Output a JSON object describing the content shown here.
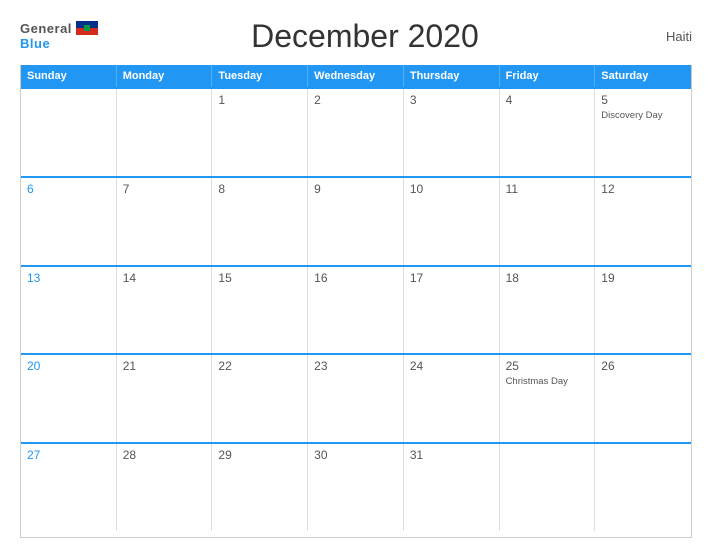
{
  "header": {
    "logo_general": "General",
    "logo_blue": "Blue",
    "title": "December 2020",
    "country": "Haiti"
  },
  "days_of_week": [
    "Sunday",
    "Monday",
    "Tuesday",
    "Wednesday",
    "Thursday",
    "Friday",
    "Saturday"
  ],
  "weeks": [
    [
      {
        "day": "",
        "empty": true
      },
      {
        "day": "",
        "empty": true
      },
      {
        "day": "1",
        "empty": false
      },
      {
        "day": "2",
        "empty": false
      },
      {
        "day": "3",
        "empty": false
      },
      {
        "day": "4",
        "empty": false
      },
      {
        "day": "5",
        "empty": false,
        "event": "Discovery Day"
      }
    ],
    [
      {
        "day": "6",
        "empty": false
      },
      {
        "day": "7",
        "empty": false
      },
      {
        "day": "8",
        "empty": false
      },
      {
        "day": "9",
        "empty": false
      },
      {
        "day": "10",
        "empty": false
      },
      {
        "day": "11",
        "empty": false
      },
      {
        "day": "12",
        "empty": false
      }
    ],
    [
      {
        "day": "13",
        "empty": false
      },
      {
        "day": "14",
        "empty": false
      },
      {
        "day": "15",
        "empty": false
      },
      {
        "day": "16",
        "empty": false
      },
      {
        "day": "17",
        "empty": false
      },
      {
        "day": "18",
        "empty": false
      },
      {
        "day": "19",
        "empty": false
      }
    ],
    [
      {
        "day": "20",
        "empty": false
      },
      {
        "day": "21",
        "empty": false
      },
      {
        "day": "22",
        "empty": false
      },
      {
        "day": "23",
        "empty": false
      },
      {
        "day": "24",
        "empty": false
      },
      {
        "day": "25",
        "empty": false,
        "event": "Christmas Day"
      },
      {
        "day": "26",
        "empty": false
      }
    ],
    [
      {
        "day": "27",
        "empty": false
      },
      {
        "day": "28",
        "empty": false
      },
      {
        "day": "29",
        "empty": false
      },
      {
        "day": "30",
        "empty": false
      },
      {
        "day": "31",
        "empty": false
      },
      {
        "day": "",
        "empty": true
      },
      {
        "day": "",
        "empty": true
      }
    ]
  ]
}
